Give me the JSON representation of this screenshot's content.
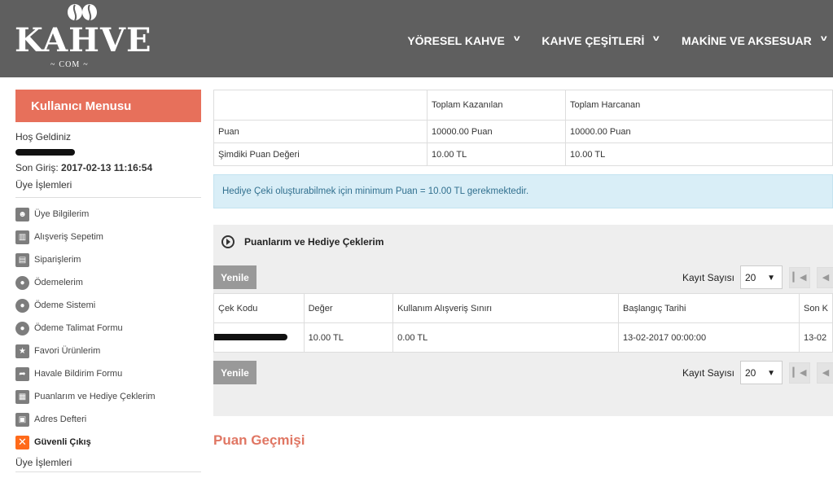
{
  "brand": {
    "name": "KAHVE",
    "sub": "COM"
  },
  "nav": [
    {
      "label": "YÖRESEL KAHVE"
    },
    {
      "label": "KAHVE ÇEŞİTLERİ"
    },
    {
      "label": "MAKİNE VE AKSESUAR"
    }
  ],
  "sidebar": {
    "title": "Kullanıcı Menusu",
    "welcome": "Hoş Geldiniz",
    "last_login_label": "Son Giriş:",
    "last_login_value": "2017-02-13 11:16:54",
    "section_title": "Üye İşlemleri",
    "items": [
      {
        "label": "Üye Bilgilerim",
        "icon": "user-icon"
      },
      {
        "label": "Alışveriş Sepetim",
        "icon": "basket-icon"
      },
      {
        "label": "Siparişlerim",
        "icon": "document-icon"
      },
      {
        "label": "Ödemelerim",
        "icon": "coin-icon"
      },
      {
        "label": "Ödeme Sistemi",
        "icon": "coin-icon"
      },
      {
        "label": "Ödeme Talimat Formu",
        "icon": "coin-icon"
      },
      {
        "label": "Favori Ürünlerim",
        "icon": "star-icon"
      },
      {
        "label": "Havale Bildirim Formu",
        "icon": "share-arrow-icon"
      },
      {
        "label": "Puanlarım ve Hediye Çeklerim",
        "icon": "gift-card-icon"
      },
      {
        "label": "Adres Defteri",
        "icon": "address-card-icon"
      },
      {
        "label": "Güvenli Çıkış",
        "icon": "close-icon"
      }
    ],
    "footer_title": "Üye İşlemleri"
  },
  "summary": {
    "headers": [
      "",
      "Toplam Kazanılan",
      "Toplam Harcanan"
    ],
    "rows": [
      [
        "Puan",
        "10000.00 Puan",
        "10000.00 Puan"
      ],
      [
        "Şimdiki Puan Değeri",
        "10.00 TL",
        "10.00 TL"
      ]
    ]
  },
  "info_message": "Hediye Çeki oluşturabilmek için minimum Puan = 10.00 TL gerekmektedir.",
  "panel": {
    "title": "Puanlarım ve Hediye Çeklerim",
    "refresh_label": "Yenile",
    "count_label": "Kayıt Sayısı",
    "page_size": "20",
    "columns": [
      "Çek Kodu",
      "Değer",
      "Kullanım Alışveriş Sınırı",
      "Başlangıç Tarihi",
      "Son K"
    ],
    "rows": [
      [
        "",
        "10.00 TL",
        "0.00 TL",
        "13-02-2017 00:00:00",
        "13-02"
      ]
    ]
  },
  "history_title": "Puan Geçmişi",
  "colors": {
    "header": "#5f5f5f",
    "accent": "#e7705b",
    "info_bg": "#d9eef7",
    "info_text": "#31708f"
  }
}
